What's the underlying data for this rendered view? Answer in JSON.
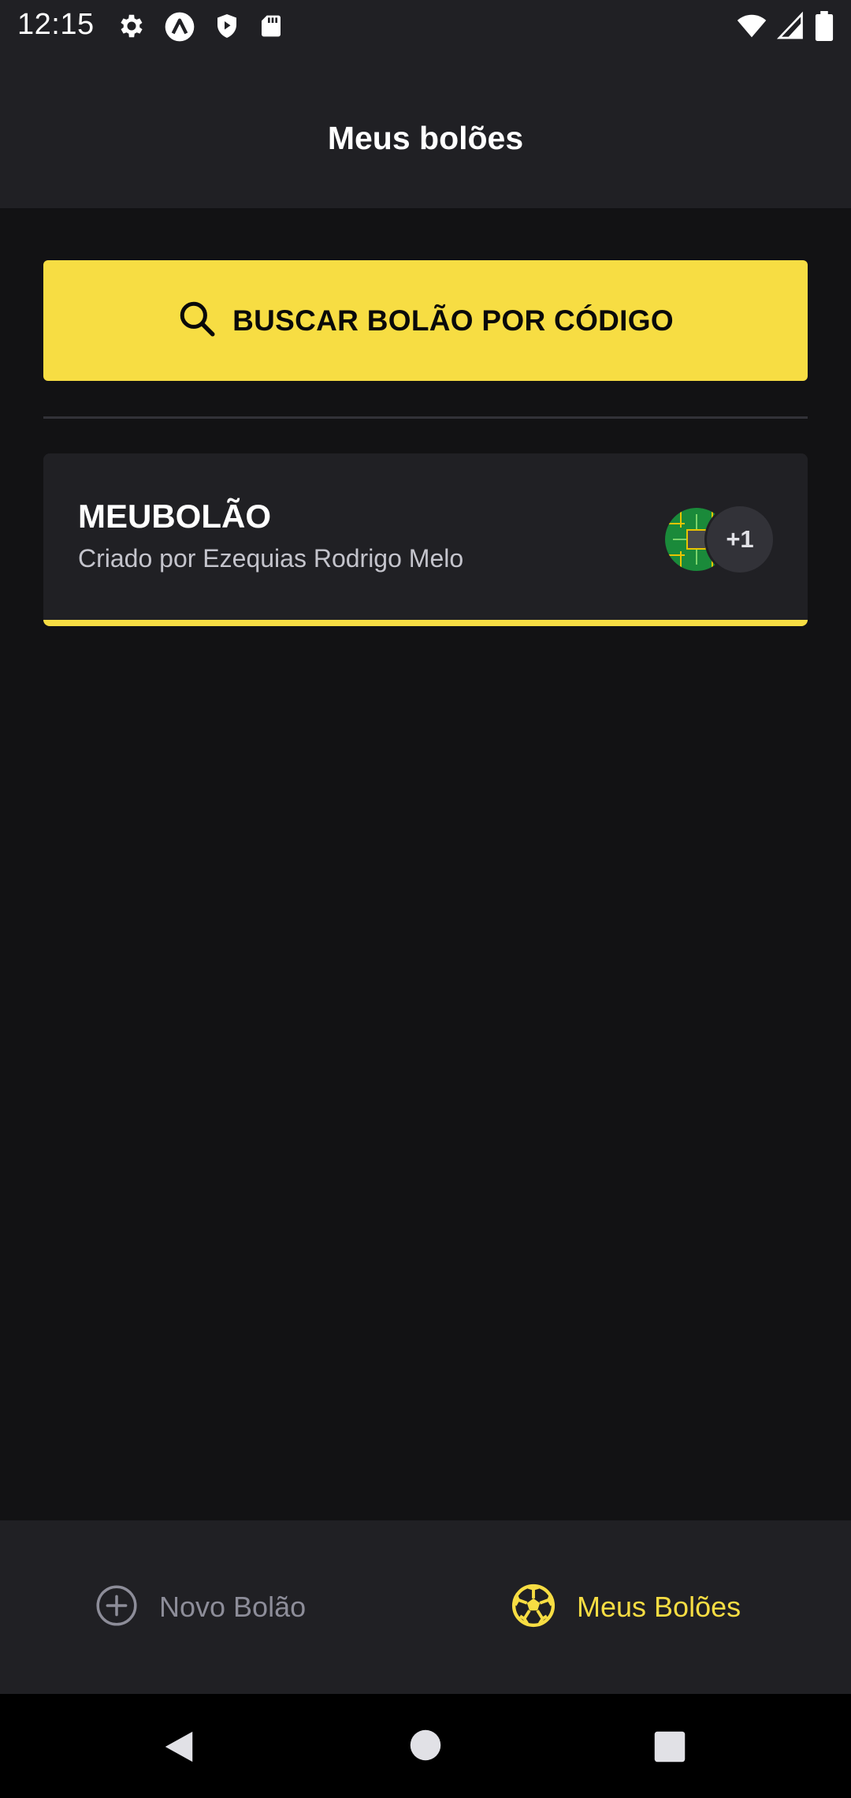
{
  "status_bar": {
    "time": "12:15",
    "icons_left": [
      "settings-icon",
      "adaptive-icon",
      "shield-icon",
      "sd-card-icon"
    ],
    "icons_right": [
      "wifi-icon",
      "signal-icon",
      "battery-icon"
    ]
  },
  "header": {
    "title": "Meus bolões"
  },
  "search": {
    "label": "BUSCAR BOLÃO POR CÓDIGO",
    "icon": "search-icon"
  },
  "pools": [
    {
      "title": "MEUBOLÃO",
      "owner_line": "Criado por Ezequias Rodrigo Melo",
      "extra_participants": "+1"
    }
  ],
  "tabs": [
    {
      "label": "Novo Bolão",
      "icon": "plus-circle-icon",
      "active": false
    },
    {
      "label": "Meus Bolões",
      "icon": "soccer-ball-icon",
      "active": true
    }
  ],
  "nav_bar": {
    "buttons": [
      "back",
      "home",
      "recents"
    ]
  },
  "colors": {
    "accent": "#f7dd43",
    "background": "#121214",
    "surface": "#202024",
    "muted_text": "#8d8d99"
  }
}
